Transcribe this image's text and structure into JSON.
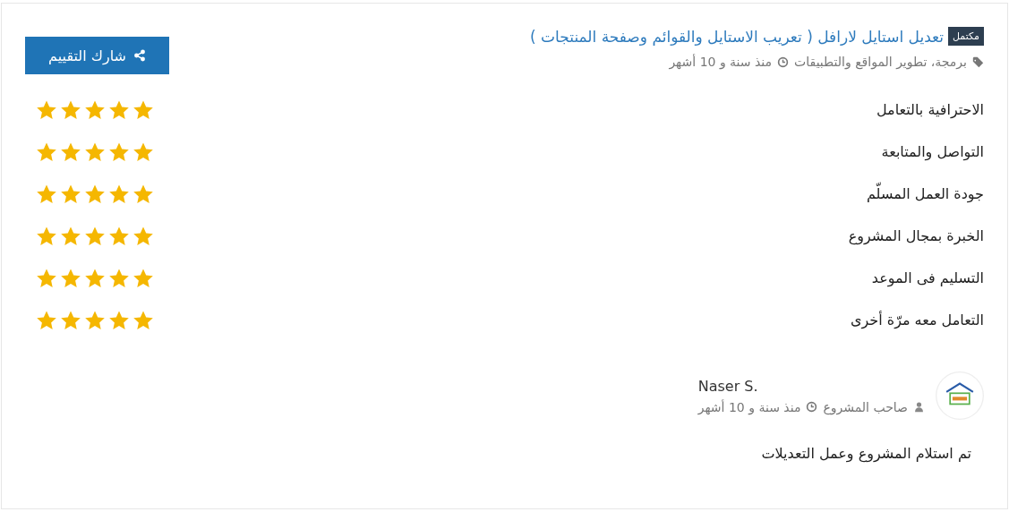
{
  "project": {
    "status_badge": "مكتمل",
    "title": "تعديل استايل لارافل ( تعريب الاستايل والقوائم وصفحة المنتجات )",
    "category": "برمجة، تطوير المواقع والتطبيقات",
    "time": "منذ سنة و 10 أشهر"
  },
  "share_button": "شارك التقييم",
  "ratings": [
    {
      "label": "الاحترافية بالتعامل",
      "stars": 5
    },
    {
      "label": "التواصل والمتابعة",
      "stars": 5
    },
    {
      "label": "جودة العمل المسلّم",
      "stars": 5
    },
    {
      "label": "الخبرة بمجال المشروع",
      "stars": 5
    },
    {
      "label": "التسليم فى الموعد",
      "stars": 5
    },
    {
      "label": "التعامل معه مرّة أخرى",
      "stars": 5
    }
  ],
  "review": {
    "name": "Naser S.",
    "role": "صاحب المشروع",
    "time": "منذ سنة و 10 أشهر",
    "comment": "تم استلام المشروع وعمل التعديلات"
  }
}
